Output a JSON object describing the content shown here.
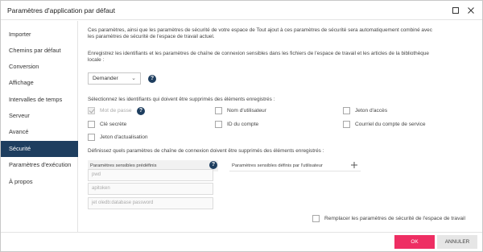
{
  "window": {
    "title": "Paramètres d'application par défaut"
  },
  "sidebar": {
    "items": [
      {
        "label": "Importer"
      },
      {
        "label": "Chemins par défaut"
      },
      {
        "label": "Conversion"
      },
      {
        "label": "Affichage"
      },
      {
        "label": "Intervalles de temps"
      },
      {
        "label": "Serveur"
      },
      {
        "label": "Avancé"
      },
      {
        "label": "Sécurité"
      },
      {
        "label": "Paramètres d'exécution"
      },
      {
        "label": "À propos"
      }
    ],
    "active_index": 7
  },
  "content": {
    "intro_line1": "Ces paramètres, ainsi que les paramètres de sécurité de votre espace de   Tout ajout à ces paramètres de sécurité sera automatiquement combiné avec",
    "intro_line2": "les paramètres de sécurité de l'espace de travail actuel.",
    "save_desc_line1": "Enregistrez les identifiants et les paramètres de chaîne de connexion sensibles dans les fichiers de l'espace de travail et les articles de la bibliothèque",
    "save_desc_line2": "locale :",
    "save_mode": {
      "value": "Demander"
    },
    "identifiers_heading": "Sélectionnez les identifiants qui doivent être supprimés des éléments enregistrés :",
    "checkboxes": [
      {
        "label": "Mot de passe",
        "checked": true,
        "disabled": true
      },
      {
        "label": "Nom d'utilisateur",
        "checked": false,
        "disabled": false
      },
      {
        "label": "Jeton d'accès",
        "checked": false,
        "disabled": false
      },
      {
        "label": "Clé secrète",
        "checked": false,
        "disabled": false
      },
      {
        "label": "ID du compte",
        "checked": false,
        "disabled": false
      },
      {
        "label": "Courriel du compte de service",
        "checked": false,
        "disabled": false
      },
      {
        "label": "Jeton d'actualisation",
        "checked": false,
        "disabled": false
      }
    ],
    "conn_heading": "Définissez quels paramètres de chaîne de connexion doivent être supprimés des éléments enregistrés :",
    "predefined": {
      "header": "Paramètres sensibles prédéfinis",
      "items": [
        "pwd",
        "apitoken",
        "jet oledb:database password"
      ]
    },
    "user_defined": {
      "header": "Paramètres sensibles définis par l'utilisateur"
    },
    "replace_label": "Remplacer les paramètres de sécurité de l'espace de travail",
    "replace_checked": false
  },
  "footer": {
    "ok_label": "OK",
    "cancel_label": "ANNULER"
  },
  "colors": {
    "accent": "#1e3e5f",
    "primary_button": "#ee2e63"
  },
  "icons": {
    "help": "help-circle-icon",
    "add": "plus-icon",
    "maximize": "maximize-icon",
    "close": "close-icon",
    "dropdown": "chevron-down-icon"
  }
}
